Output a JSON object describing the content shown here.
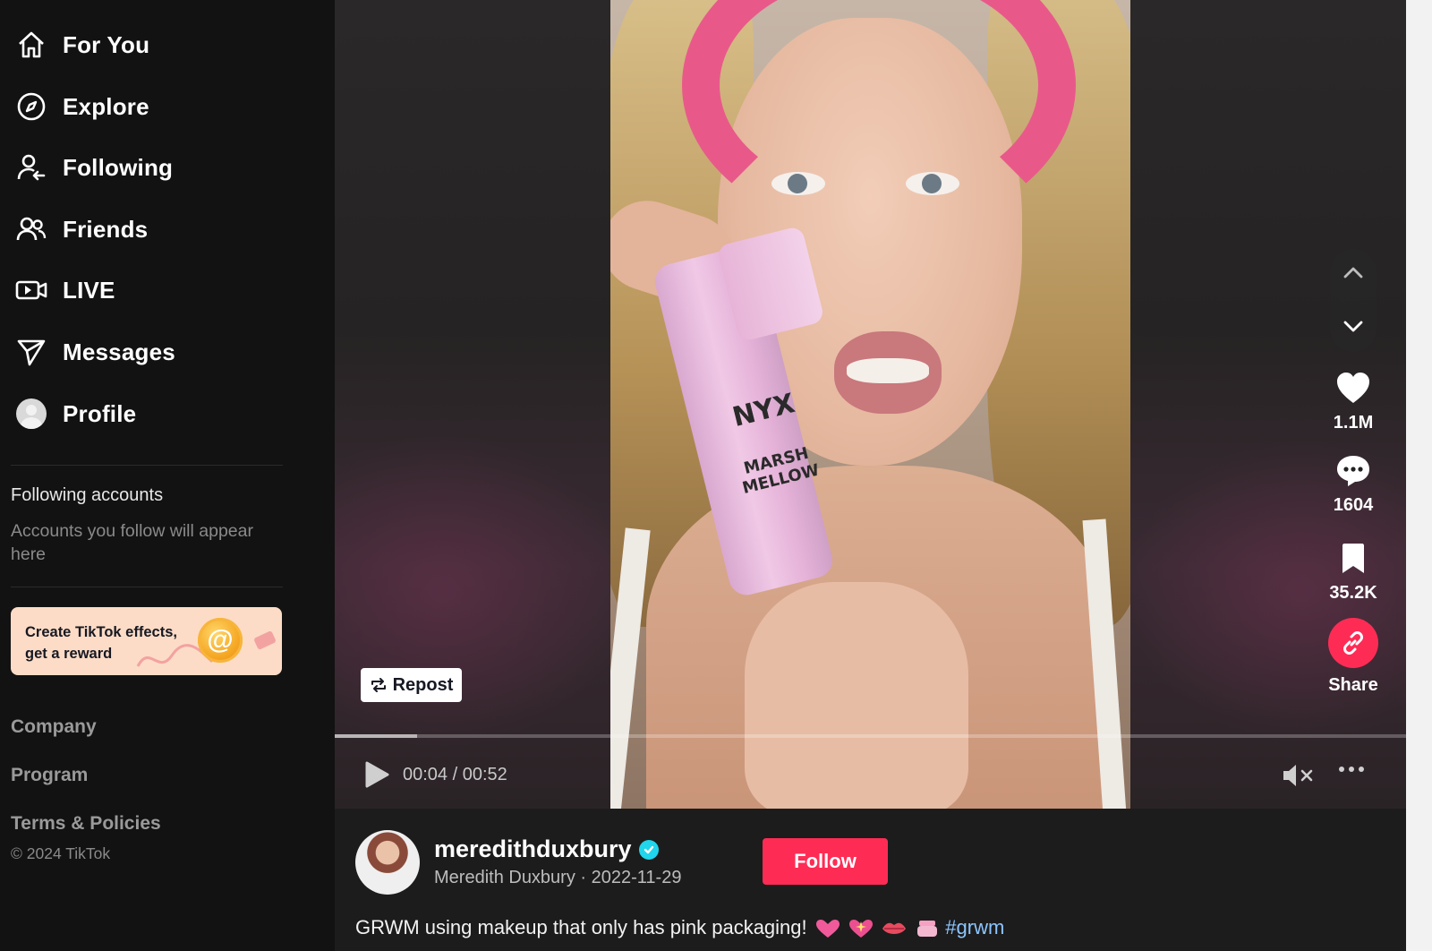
{
  "sidebar": {
    "nav": [
      {
        "label": "For You",
        "icon": "home-icon"
      },
      {
        "label": "Explore",
        "icon": "compass-icon"
      },
      {
        "label": "Following",
        "icon": "user-following-icon"
      },
      {
        "label": "Friends",
        "icon": "friends-icon"
      },
      {
        "label": "LIVE",
        "icon": "live-camera-icon"
      },
      {
        "label": "Messages",
        "icon": "paper-plane-icon"
      },
      {
        "label": "Profile",
        "icon": "profile-avatar-icon"
      }
    ],
    "following_title": "Following accounts",
    "following_desc": "Accounts you follow will appear here",
    "promo": {
      "line1": "Create TikTok effects,",
      "line2": "get a reward",
      "coin_glyph": "@"
    },
    "footer": {
      "company": "Company",
      "program": "Program",
      "terms": "Terms & Policies",
      "copyright": "© 2024 TikTok"
    }
  },
  "video": {
    "repost_label": "Repost",
    "time": "00:04 / 00:52",
    "progress_fraction": 0.077,
    "bottle_brand": "NYX",
    "bottle_product": "MARSH MELLOW"
  },
  "actions": {
    "likes": "1.1M",
    "comments": "1604",
    "saves": "35.2K",
    "share_label": "Share"
  },
  "post": {
    "username": "meredithduxbury",
    "display_name": "Meredith Duxbury",
    "date": "2022-11-29",
    "separator": " · ",
    "follow_label": "Follow",
    "caption": "GRWM using makeup that only has pink packaging!",
    "hashtag": "#grwm"
  },
  "colors": {
    "accent": "#fe2c55",
    "verified": "#20d5ec",
    "hashtag": "#8ec5ff",
    "sidebar_bg": "#121212"
  }
}
